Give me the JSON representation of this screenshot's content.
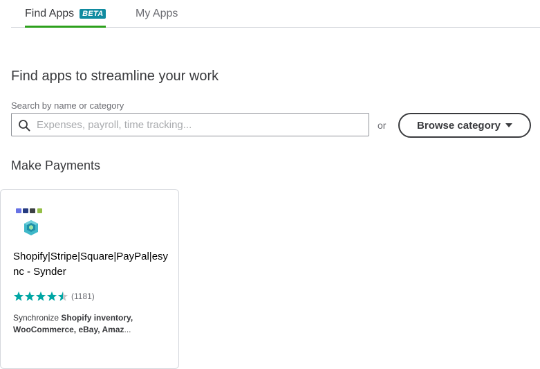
{
  "tabs": {
    "find_apps": "Find Apps",
    "beta_badge": "BETA",
    "my_apps": "My Apps"
  },
  "headline": "Find apps to streamline your work",
  "search": {
    "label": "Search by name or category",
    "placeholder": "Expenses, payroll, time tracking...",
    "value": ""
  },
  "or_text": "or",
  "browse_label": "Browse category",
  "section_title": "Make Payments",
  "app_card": {
    "name": "Shopify|Stripe|Square|PayPal|esync - Synder",
    "rating_value": 4.5,
    "rating_max": 5,
    "rating_count": "(1181)",
    "desc_prefix": "Synchronize ",
    "desc_bold": "Shopify inventory, WooCommerce, eBay, Amaz",
    "desc_ellipsis": "..."
  },
  "colors": {
    "tab_active_underline": "#2ca01c",
    "badge_bg": "#108ba0",
    "star_fill": "#00a6a4",
    "star_empty": "#c4c6c9"
  },
  "icons": {
    "search": "search-icon",
    "caret": "caret-down-icon",
    "star": "star-icon",
    "logo": "synder-logo-icon"
  }
}
